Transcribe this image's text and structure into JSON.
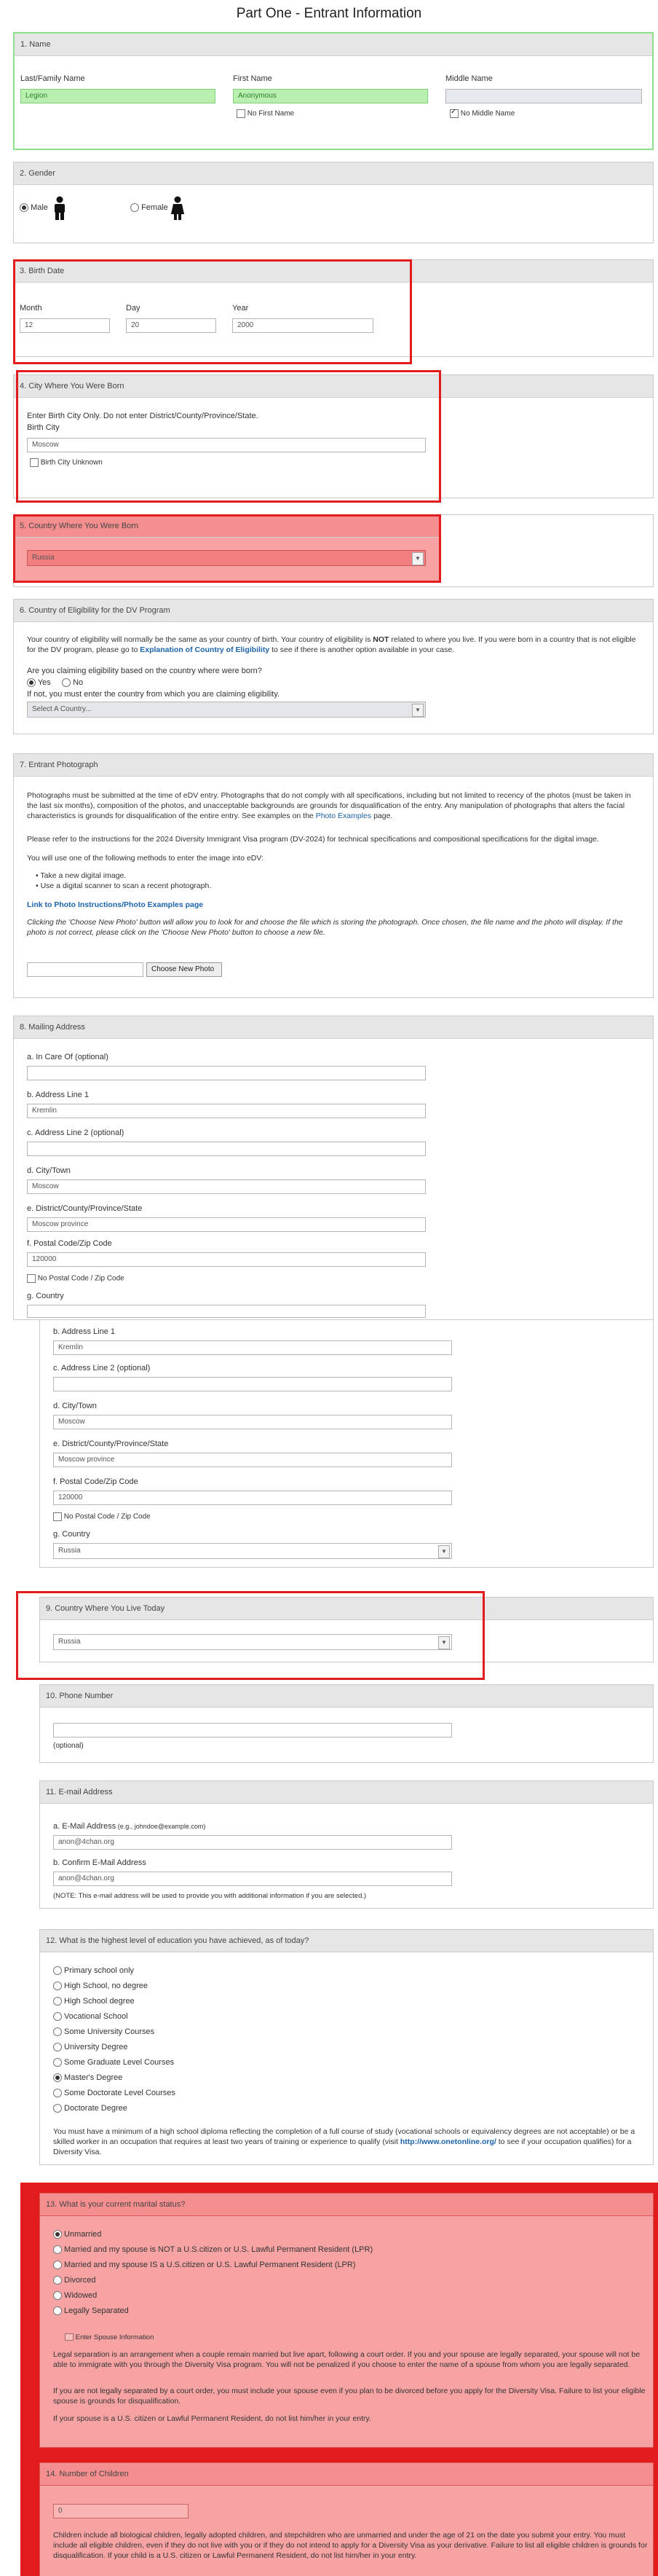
{
  "page_title": "Part One - Entrant Information",
  "s1": {
    "title": "1. Name",
    "last_label": "Last/Family Name",
    "last_val": "Legion",
    "first_label": "First Name",
    "first_val": "Anonymous",
    "middle_label": "Middle Name",
    "middle_val": "",
    "no_first": "No First Name",
    "no_middle": "No Middle Name"
  },
  "s2": {
    "title": "2. Gender",
    "male": "Male",
    "female": "Female"
  },
  "s3": {
    "title": "3. Birth Date",
    "month_label": "Month",
    "month_val": "12",
    "day_label": "Day",
    "day_val": "20",
    "year_label": "Year",
    "year_val": "2000"
  },
  "s4": {
    "title": "4. City Where You Were Born",
    "hint": "Enter Birth City Only. Do not enter District/County/Province/State.",
    "city_label": "Birth City",
    "city_val": "Moscow",
    "unknown": "Birth City Unknown"
  },
  "s5": {
    "title": "5. Country Where You Were Born",
    "val": "Russia"
  },
  "s6": {
    "title": "6. Country of Eligibility for the DV Program",
    "p1a": "Your country of eligibility will normally be the same as your country of birth. Your country of eligibility is ",
    "p1b": "NOT",
    "p1c": " related to where you live. If you were born in a country that is not eligible for the DV program, please go to ",
    "p1link": "Explanation of Country of Eligibility",
    "p1d": " to see if there is another option available in your case.",
    "q": "Are you claiming eligibility based on the country where were born?",
    "yes": "Yes",
    "no": "No",
    "ifnot": "If not, you must enter the country from which you are claiming eligibility.",
    "select": "Select A Country..."
  },
  "s7": {
    "title": "7. Entrant Photograph",
    "p1": "Photographs must be submitted at the time of eDV entry. Photographs that do not comply with all specifications, including but not limited to recency of the photos (must be taken in the last six months), composition of the photos, and unacceptable backgrounds are grounds for disqualification of the entry. Any manipulation of photographs that alters the facial characteristics is grounds for disqualification of the entire entry. See examples on the ",
    "p1link": "Photo Examples",
    "p1end": " page.",
    "p2": "Please refer to the instructions for the 2024 Diversity Immigrant Visa program (DV-2024) for technical specifications and compositional specifications for the digital image.",
    "p3": "You will use one of the following methods to enter the image into eDV:",
    "b1": "Take a new digital image.",
    "b2": "Use a digital scanner to scan a recent photograph.",
    "link": "Link to Photo Instructions/Photo Examples page",
    "p4": "Clicking the 'Choose New Photo' button will allow you to look for and choose the file which is storing the photograph. Once chosen, the file name and the photo will display. If the photo is not correct, please click on the 'Choose New Photo' button to choose a new file.",
    "button": "Choose New Photo"
  },
  "s8": {
    "title": "8. Mailing Address",
    "incare_label": "a. In Care Of (optional)",
    "incare_val": "",
    "addr1_label": "b. Address Line 1",
    "addr1_val": "Kremlin",
    "addr2_label": "c. Address Line 2 (optional)",
    "addr2_val": "",
    "city_label": "d. City/Town",
    "city_val": "Moscow",
    "district_label": "e. District/County/Province/State",
    "district_val": "Moscow province",
    "postal_label": "f. Postal Code/Zip Code",
    "postal_val": "120000",
    "nopostal": "No Postal Code / Zip Code",
    "country_label": "g. Country",
    "country_val": "Russia"
  },
  "s9": {
    "title": "9. Country Where You Live Today",
    "val": "Russia"
  },
  "s10": {
    "title": "10. Phone Number",
    "val": "",
    "optional": "(optional)"
  },
  "s11": {
    "title": "11. E-mail Address",
    "email_label": "a. E-Mail Address",
    "email_hint": " (e.g., johndoe@example.com)",
    "email_val": "anon@4chan.org",
    "confirm_label": "b. Confirm E-Mail Address",
    "confirm_val": "anon@4chan.org",
    "note": "(NOTE: This e-mail address will be used to provide you with additional information if you are selected.)"
  },
  "s12": {
    "title": "12. What is the highest level of education you have achieved, as of today?",
    "options": [
      "Primary school only",
      "High School, no degree",
      "High School degree",
      "Vocational School",
      "Some University Courses",
      "University Degree",
      "Some Graduate Level Courses",
      "Master's Degree",
      "Some Doctorate Level Courses",
      "Doctorate Degree"
    ],
    "selected": "Master's Degree",
    "p1": "You must have a minimum of a high school diploma reflecting the completion of a full course of study (vocational schools or equivalency degrees are not acceptable) or be a skilled worker in an occupation that requires at least two years of training or experience to qualify (visit ",
    "p1link": "http://www.onetonline.org/",
    "p1end": " to see if your occupation qualifies) for a Diversity Visa."
  },
  "s13": {
    "title": "13. What is your current marital status?",
    "options": [
      "Unmarried",
      "Married and my spouse is NOT a U.S.citizen or U.S. Lawful Permanent Resident (LPR)",
      "Married and my spouse IS a U.S.citizen or U.S. Lawful Permanent Resident (LPR)",
      "Divorced",
      "Widowed",
      "Legally Separated"
    ],
    "selected": "Unmarried",
    "spouse_info": "Enter Spouse Information",
    "p1": "Legal separation is an arrangement when a couple remain married but live apart, following a court order. If you and your spouse are legally separated, your spouse will not be able to immigrate with you through the Diversity Visa program. You will not be penalized if you choose to enter the name of a spouse from whom you are legally separated.",
    "p2": "If you are not legally separated by a court order, you must include your spouse even if you plan to be divorced before you apply for the Diversity Visa. Failure to list your eligible spouse is grounds for disqualification.",
    "p3": "If your spouse is a U.S. citizen or Lawful Permanent Resident, do not list him/her in your entry."
  },
  "s14": {
    "title": "14. Number of Children",
    "val": "0",
    "p1": "Children include all biological children, legally adopted children, and stepchildren who are unmarried and under the age of 21 on the date you submit your entry. You must include all eligible children, even if they do not live with you or if they do not intend to apply for a Diversity Visa as your derivative. Failure to list all eligible children is grounds for disqualification. If your child is a U.S. citizen or Lawful Permanent Resident, do not list him/her in your entry."
  },
  "colors": {
    "highlight_red": "#e21c1c",
    "highlight_green": "#8ee08a",
    "link": "#1c63a8"
  }
}
